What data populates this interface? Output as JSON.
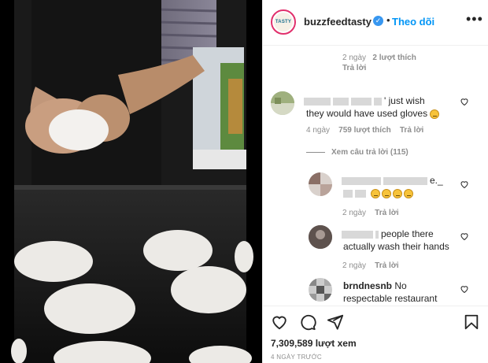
{
  "header": {
    "avatar_text": "TASTY",
    "username": "buzzfeedtasty",
    "verified_mark": "✓",
    "separator": "•",
    "follow_label": "Theo dõi",
    "more_label": "•••"
  },
  "comments": {
    "c0": {
      "time": "2 ngày",
      "likes": "2 lượt thích",
      "reply": "Trả lời"
    },
    "c1": {
      "text_tail": "' just wish",
      "text_line2": "they would have used gloves",
      "time": "4 ngày",
      "likes": "759 lượt thích",
      "reply": "Trả lời",
      "view_replies": "Xem câu trả lời (115)"
    },
    "r1": {
      "text_tail": "e._",
      "time": "2 ngày",
      "reply": "Trả lời"
    },
    "r2": {
      "text_tail": "people there",
      "text_line2": "actually wash their hands",
      "time": "2 ngày",
      "reply": "Trả lời"
    },
    "r3": {
      "username": "brndnesnb",
      "text_tail": "No",
      "text_line2": "respectable restaurant"
    }
  },
  "footer": {
    "views": "7,309,589 lượt xem",
    "time": "4 NGÀY TRƯỚC"
  },
  "icons": {
    "like": "heart-icon",
    "comment": "comment-icon",
    "share": "share-icon",
    "save": "bookmark-icon"
  },
  "colors": {
    "accent": "#0095f6",
    "verified": "#3897f0",
    "muted": "#8e8e8e"
  }
}
